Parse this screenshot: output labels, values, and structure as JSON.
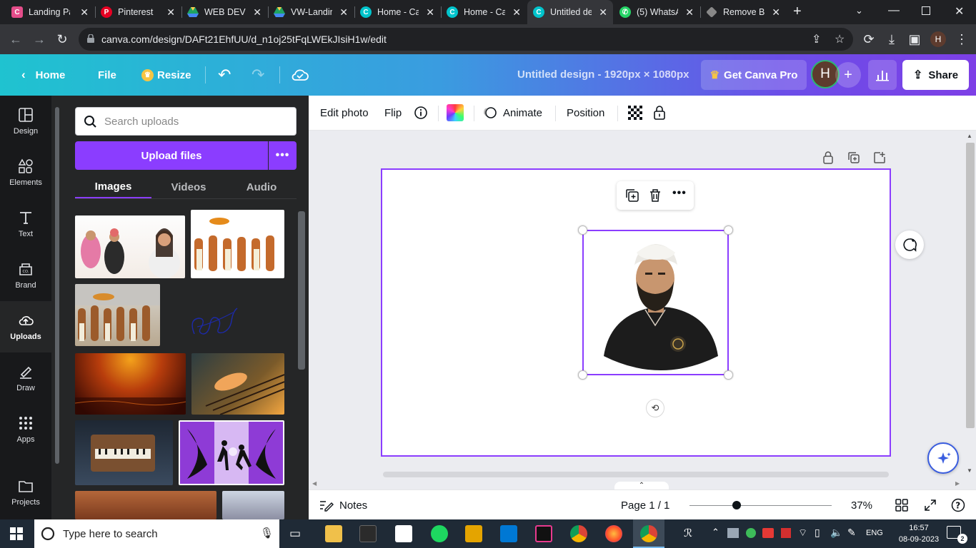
{
  "browser": {
    "tabs": [
      {
        "title": "Landing Pa",
        "favicon": "canva-pink-icon",
        "color": "#e44d8a"
      },
      {
        "title": "Pinterest",
        "favicon": "pinterest-icon",
        "color": "#e60023"
      },
      {
        "title": "WEB DEVE",
        "favicon": "google-drive-icon",
        "color": "#1fa463"
      },
      {
        "title": "VW-Landir",
        "favicon": "google-drive-icon",
        "color": "#1fa463"
      },
      {
        "title": "Home - Ca",
        "favicon": "canva-icon",
        "color": "#00c4cc"
      },
      {
        "title": "Home - Ca",
        "favicon": "canva-icon",
        "color": "#00c4cc"
      },
      {
        "title": "Untitled de",
        "favicon": "canva-icon",
        "color": "#00c4cc"
      },
      {
        "title": "(5) WhatsA",
        "favicon": "whatsapp-icon",
        "color": "#25d366"
      },
      {
        "title": "Remove Ba",
        "favicon": "remove-bg-icon",
        "color": "#888888"
      }
    ],
    "url": "canva.com/design/DAFt21EhfUU/d_n1oj25tFqLWEkJIsiH1w/edit",
    "profile_initial": "H"
  },
  "header": {
    "home": "Home",
    "file": "File",
    "resize": "Resize",
    "doc_title": "Untitled design - 1920px × 1080px",
    "get_pro": "Get Canva Pro",
    "avatar_initial": "H",
    "share": "Share"
  },
  "rail": [
    {
      "label": "Design",
      "icon": "layout-icon"
    },
    {
      "label": "Elements",
      "icon": "shapes-icon"
    },
    {
      "label": "Text",
      "icon": "text-icon"
    },
    {
      "label": "Brand",
      "icon": "brand-icon"
    },
    {
      "label": "Uploads",
      "icon": "cloud-upload-icon",
      "active": true
    },
    {
      "label": "Draw",
      "icon": "pen-icon"
    },
    {
      "label": "Apps",
      "icon": "apps-grid-icon"
    },
    {
      "label": "Projects",
      "icon": "folder-icon"
    }
  ],
  "panel": {
    "search_placeholder": "Search uploads",
    "upload_button": "Upload files",
    "tabs": [
      "Images",
      "Videos",
      "Audio"
    ],
    "active_tab": "Images"
  },
  "toolbar": {
    "edit_photo": "Edit photo",
    "flip": "Flip",
    "animate": "Animate",
    "position": "Position"
  },
  "footer": {
    "notes": "Notes",
    "page_indicator": "Page 1 / 1",
    "zoom": "37%"
  },
  "taskbar": {
    "search_text": "Type here to search",
    "language": "ENG",
    "time": "16:57",
    "date": "08-09-2023",
    "notifications": "2"
  },
  "colors": {
    "accent": "#8b3dff",
    "header_gradient_start": "#1fc3d0",
    "header_gradient_end": "#7d3fe6"
  }
}
